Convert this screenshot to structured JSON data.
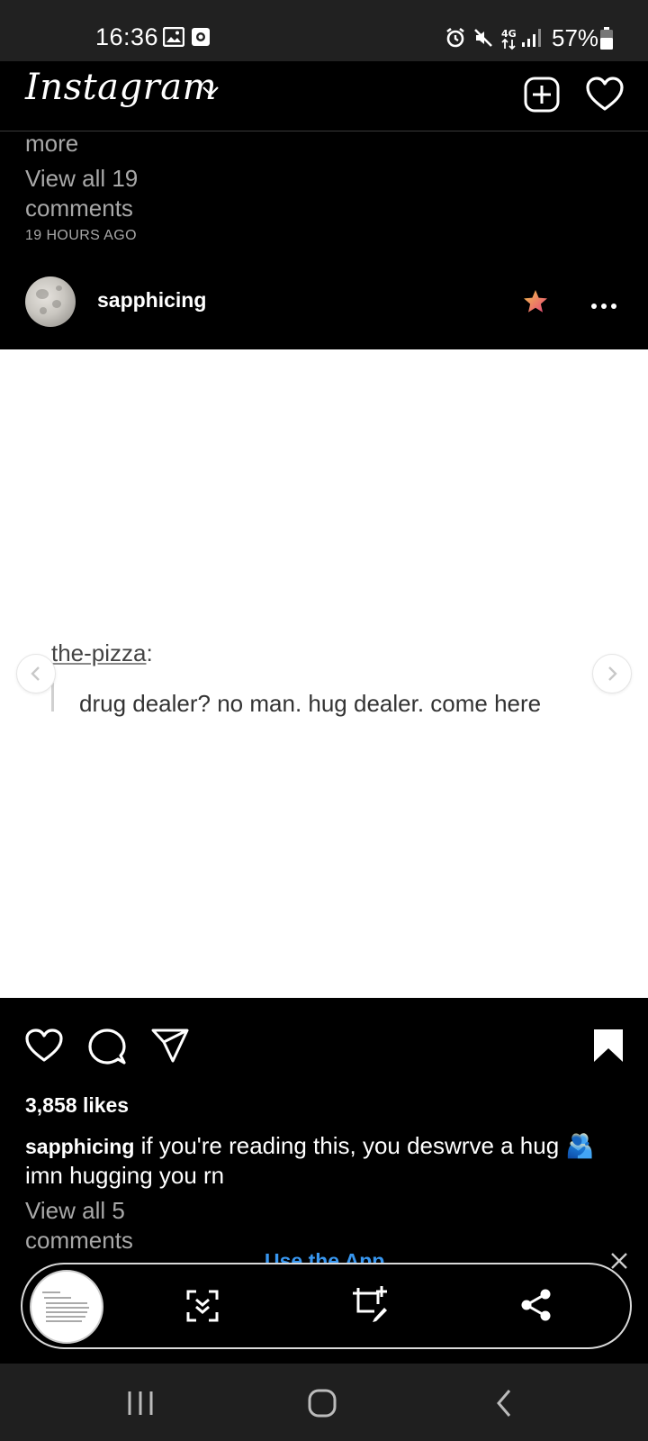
{
  "status_bar": {
    "time": "16:36",
    "battery_percent": "57%",
    "icons": [
      "gallery-icon",
      "screen-record-icon",
      "alarm-icon",
      "mute-icon",
      "4g-icon",
      "signal-icon",
      "battery-icon"
    ]
  },
  "header": {
    "logo": "Instagram",
    "icons": [
      "chevron-down-icon",
      "new-post-icon",
      "heart-icon"
    ]
  },
  "previous_post": {
    "more": "more",
    "view_all_comments": "View all 19 comments",
    "timestamp": "19 HOURS AGO"
  },
  "post": {
    "username": "sapphicing",
    "badge_icon": "star-icon",
    "image": {
      "author": "the-pizza",
      "author_suffix": ":",
      "quote": "drug dealer? no man. hug dealer. come here"
    },
    "likes": "3,858 likes",
    "caption_user": "sapphicing",
    "caption_text": " if you're reading this, you deswrve a hug 🫂 imn hugging you rn",
    "view_comments": "View all 5 comments"
  },
  "banner": {
    "use_app": "Use the App"
  },
  "screenshot_toolbar": {
    "icons": [
      "scroll-capture-icon",
      "crop-edit-icon",
      "share-icon"
    ]
  },
  "nav_bar": {
    "icons": [
      "recents-icon",
      "home-icon",
      "back-icon"
    ]
  },
  "colors": {
    "background": "#000000",
    "status_bar": "#212121",
    "secondary_text": "#a8a8a8",
    "link_blue": "#3897f0",
    "star_gradient_start": "#f3c34a",
    "star_gradient_end": "#e6457a"
  }
}
